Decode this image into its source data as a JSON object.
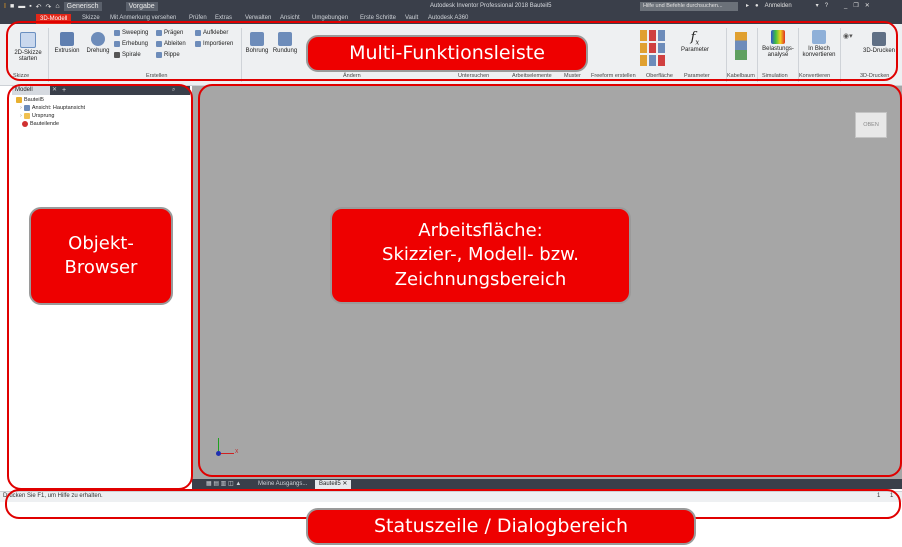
{
  "app": {
    "title": "Autodesk Inventor Professional 2018   Bauteil5",
    "quick_access": {
      "material_combo": "Generisch",
      "appearance_combo": "Vorgabe"
    },
    "help_search_placeholder": "Hilfe und Befehle durchsuchen...",
    "sign_in": "Anmelden"
  },
  "ribbon_tabs": [
    "3D-Modell",
    "Skizze",
    "Mit Anmerkung versehen",
    "Prüfen",
    "Extras",
    "Verwalten",
    "Ansicht",
    "Umgebungen",
    "Erste Schritte",
    "Vault",
    "Autodesk A360"
  ],
  "ribbon": {
    "sketch_button": "2D-Skizze starten",
    "extrusion": "Extrusion",
    "rotation": "Drehung",
    "sweeping": "Sweeping",
    "lofting": "Erhebung",
    "spiral": "Spirale",
    "emboss": "Prägen",
    "derive": "Ableiten",
    "rib": "Rippe",
    "decal": "Aufkleber",
    "import": "Importieren",
    "hole": "Bohrung",
    "fillet": "Rundung",
    "parameter": "Parameter",
    "stress_analysis": "Belastungs- analyse",
    "convert_sheet": "In Blech konvertieren",
    "print_3d": "3D-Drucken",
    "panels": {
      "sketch": "Skizze",
      "create": "Erstellen",
      "modify": "Ändern",
      "explore": "Untersuchen",
      "work_features": "Arbeitselemente",
      "pattern": "Muster",
      "freeform": "Freeform erstellen",
      "surface": "Oberfläche",
      "parameter": "Parameter",
      "cable": "Kabelbaum",
      "simulation": "Simulation",
      "convert": "Konvertieren",
      "print3d": "3D-Drucken"
    }
  },
  "browser": {
    "tab_label": "Modell",
    "tree": [
      "Bauteil5",
      "Ansicht: Hauptansicht",
      "Ursprung",
      "Bauteilende"
    ]
  },
  "workspace": {
    "viewcube_label": "OBEN",
    "axis_x": "X"
  },
  "doc_tabs": [
    "Meine Ausgangs...",
    "Bauteil5"
  ],
  "status": {
    "text": "Drücken Sie F1, um Hilfe zu erhalten.",
    "counter_a": "1",
    "counter_b": "1"
  },
  "callouts": {
    "ribbon": "Multi-Funktionsleiste",
    "browser_line1": "Objekt-",
    "browser_line2": "Browser",
    "workspace_line1": "Arbeitsfläche:",
    "workspace_line2": "Skizzier-, Modell- bzw.",
    "workspace_line3": "Zeichnungsbereich",
    "status": "Statuszeile / Dialogbereich"
  },
  "colors": {
    "accent": "#e22718",
    "callout": "#ee0000",
    "workspace": "#a6a6a6",
    "chrome": "#3a3f4a"
  }
}
